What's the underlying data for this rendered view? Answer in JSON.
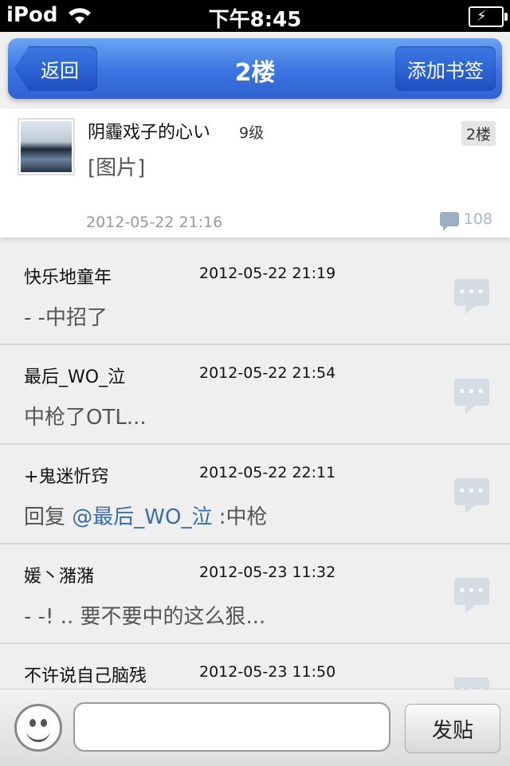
{
  "status_bar": {
    "device": "iPod",
    "time": "下午8:45"
  },
  "nav": {
    "back_label": "返回",
    "title": "2楼",
    "bookmark_label": "添加书签"
  },
  "main_post": {
    "author": "阴霾戏子的心い",
    "level": "9级",
    "floor": "2楼",
    "content": "[图片]",
    "time": "2012-05-22 21:16",
    "reply_count": "108"
  },
  "replies": [
    {
      "author": "快乐地童年",
      "time": "2012-05-22 21:19",
      "content": "- -中招了",
      "mention": "",
      "suffix": ""
    },
    {
      "author": "最后_WO_泣",
      "time": "2012-05-22 21:54",
      "content": "中枪了OTL...",
      "mention": "",
      "suffix": ""
    },
    {
      "author": "+鬼迷忻窍",
      "time": "2012-05-22 22:11",
      "content": "回复 ",
      "mention": "@最后_WO_泣",
      "suffix": " :中枪"
    },
    {
      "author": "媛丶潴潴",
      "time": "2012-05-23 11:32",
      "content": "- -! .. 要不要中的这么狠...",
      "mention": "",
      "suffix": ""
    },
    {
      "author": "不许说自己脑残",
      "time": "2012-05-23 11:50",
      "content": "",
      "mention": "",
      "suffix": ""
    }
  ],
  "reply_bubble_glyph": "•••",
  "bottom_bar": {
    "input_value": "",
    "post_label": "发贴"
  }
}
